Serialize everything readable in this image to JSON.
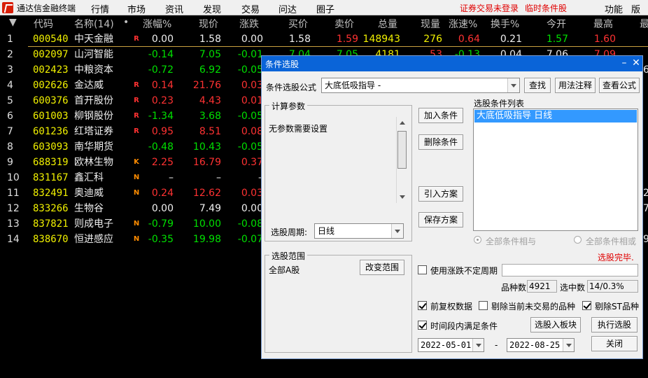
{
  "app": {
    "title": "通达信金融终端",
    "menus": [
      "行情",
      "市场",
      "资讯",
      "发现",
      "交易",
      "问达",
      "圈子"
    ],
    "warning_login": "证券交易未登录",
    "warning_condition": "临时条件股",
    "right_menus": [
      "功能",
      "版面"
    ]
  },
  "table": {
    "headers": {
      "sort": "▼",
      "code": "代码",
      "name": "名称(14)",
      "dot": "•",
      "pct": "涨幅%",
      "price": "现价",
      "change": "涨跌",
      "bid": "买价",
      "ask": "卖价",
      "volume": "总量",
      "cur_vol": "现量",
      "speed": "涨速%",
      "turnover": "换手%",
      "open": "今开",
      "high": "最高",
      "more": "最"
    },
    "rows": [
      {
        "idx": "1",
        "code": "000540",
        "name": "中天金融",
        "tag": "R",
        "pct": "0.00",
        "price": "1.58",
        "change": "0.00",
        "bid": "1.58",
        "ask": "1.59",
        "volume": "148943",
        "cur_vol": "276",
        "speed": "0.64",
        "turnover": "0.21",
        "open": "1.57",
        "high": "1.60"
      },
      {
        "idx": "2",
        "code": "002097",
        "name": "山河智能",
        "tag": "",
        "pct": "-0.14",
        "price": "7.05",
        "change": "-0.01",
        "bid": "7.04",
        "ask": "7.05",
        "volume": "4181",
        "cur_vol": "53",
        "speed": "-0.13",
        "turnover": "0.04",
        "open": "7.06",
        "high": "7.09"
      },
      {
        "idx": "3",
        "code": "002423",
        "name": "中粮资本",
        "tag": "",
        "pct": "-0.72",
        "price": "6.92",
        "change": "-0.05"
      },
      {
        "idx": "4",
        "code": "002626",
        "name": "金达威",
        "tag": "R",
        "pct": "0.14",
        "price": "21.76",
        "change": "0.03"
      },
      {
        "idx": "5",
        "code": "600376",
        "name": "首开股份",
        "tag": "R",
        "pct": "0.23",
        "price": "4.43",
        "change": "0.01"
      },
      {
        "idx": "6",
        "code": "601003",
        "name": "柳钢股份",
        "tag": "R",
        "pct": "-1.34",
        "price": "3.68",
        "change": "-0.05"
      },
      {
        "idx": "7",
        "code": "601236",
        "name": "红塔证券",
        "tag": "R",
        "pct": "0.95",
        "price": "8.51",
        "change": "0.08"
      },
      {
        "idx": "8",
        "code": "603093",
        "name": "南华期货",
        "tag": "",
        "pct": "-0.48",
        "price": "10.43",
        "change": "-0.05"
      },
      {
        "idx": "9",
        "code": "688319",
        "name": "欧林生物",
        "tag": "K",
        "pct": "2.25",
        "price": "16.79",
        "change": "0.37"
      },
      {
        "idx": "10",
        "code": "831167",
        "name": "鑫汇科",
        "tag": "N",
        "pct": "–",
        "price": "–",
        "change": "–"
      },
      {
        "idx": "11",
        "code": "832491",
        "name": "奥迪威",
        "tag": "N",
        "pct": "0.24",
        "price": "12.62",
        "change": "0.03"
      },
      {
        "idx": "12",
        "code": "833266",
        "name": "生物谷",
        "tag": "",
        "pct": "0.00",
        "price": "7.49",
        "change": "0.00"
      },
      {
        "idx": "13",
        "code": "837821",
        "name": "则成电子",
        "tag": "N",
        "pct": "-0.79",
        "price": "10.00",
        "change": "-0.08"
      },
      {
        "idx": "14",
        "code": "838670",
        "name": "恒进感应",
        "tag": "N",
        "pct": "-0.35",
        "price": "19.98",
        "change": "-0.07"
      }
    ],
    "edge_digits": [
      "6",
      "2",
      "7",
      "9"
    ]
  },
  "dialog": {
    "title": "条件选股",
    "formula_label": "条件选股公式",
    "formula_value": "大底低吸指导 -",
    "btn_find": "查找",
    "btn_usage": "用法注释",
    "btn_view": "查看公式",
    "params_group": "计算参数",
    "params_text": "无参数需要设置",
    "period_label": "选股周期:",
    "period_value": "日线",
    "btn_add": "加入条件",
    "btn_delete": "删除条件",
    "btn_import": "引入方案",
    "btn_save": "保存方案",
    "list_label": "选股条件列表",
    "list_item": "大底低吸指导  日线",
    "radio_and": "全部条件相与",
    "radio_or": "全部条件相或",
    "status": "选股完毕.",
    "range_group": "选股范围",
    "range_value": "全部A股",
    "btn_range": "改变范围",
    "chk_limit": "使用涨跌不定周期",
    "count_label": "品种数",
    "count_value": "4921",
    "selected_label": "选中数",
    "selected_value": "14/0.3%",
    "chk_restore": "前复权数据",
    "chk_exclude_untraded": "剔除当前未交易的品种",
    "chk_exclude_st": "剔除ST品种",
    "chk_period": "时间段内满足条件",
    "btn_to_block": "选股入板块",
    "btn_execute": "执行选股",
    "date_from": "2022-05-01",
    "date_sep": "-",
    "date_to": "2022-08-25",
    "btn_close": "关闭"
  }
}
